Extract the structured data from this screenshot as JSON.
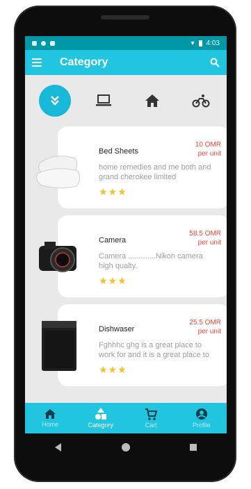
{
  "statusbar": {
    "time": "4:03"
  },
  "appbar": {
    "title": "Category"
  },
  "categories": [
    "expand",
    "laptop",
    "home",
    "bicycle"
  ],
  "products": [
    {
      "name": "Bed Sheets",
      "price": "10 OMR",
      "unit": "per unit",
      "description": "home remedies and me both and grand cherokee limited",
      "rating": 3
    },
    {
      "name": "Camera",
      "price": "58.5 OMR",
      "unit": "per unit",
      "description": "Camera .............Nikon camera high qualty.",
      "rating": 3
    },
    {
      "name": "Dishwaser",
      "price": "25.5 OMR",
      "unit": "per unit",
      "description": "Fghhhc ghg is a great place to work for and it is a great place to",
      "rating": 3
    }
  ],
  "nav": {
    "home": "Home",
    "category": "Category",
    "cart": "Cart",
    "profile": "Profile"
  },
  "colors": {
    "primary": "#22c5df",
    "statusbar": "#0097a7",
    "price": "#f44336",
    "star": "#f6c02a"
  }
}
